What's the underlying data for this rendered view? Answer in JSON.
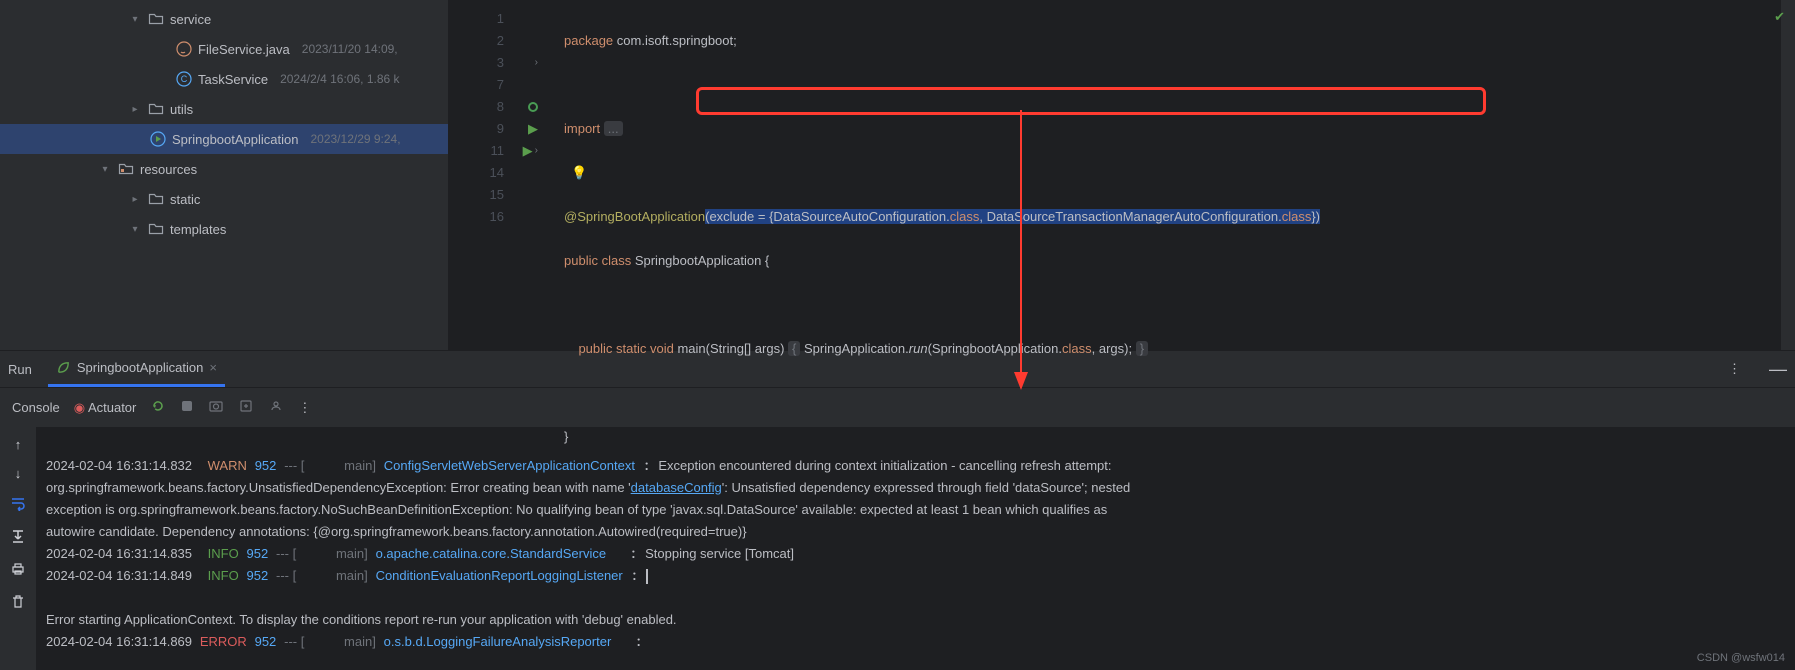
{
  "tree": {
    "service": {
      "name": "service",
      "children": [
        {
          "name": "FileService.java",
          "meta": "2023/11/20 14:09,"
        },
        {
          "name": "TaskService",
          "meta": "2024/2/4 16:06, 1.86 k"
        }
      ]
    },
    "utils": {
      "name": "utils"
    },
    "springApp": {
      "name": "SpringbootApplication",
      "meta": "2023/12/29 9:24,"
    },
    "resources": {
      "name": "resources",
      "children": [
        {
          "name": "static"
        },
        {
          "name": "templates"
        }
      ]
    }
  },
  "gutter": [
    "1",
    "2",
    "3",
    "7",
    "8",
    "9",
    "11",
    "14",
    "15",
    "16"
  ],
  "code": {
    "l1": {
      "kw": "package",
      "pkg": "com.isoft.springboot"
    },
    "l3": {
      "kw": "import",
      "dots": "..."
    },
    "l8": {
      "ann": "@SpringBootApplication"
    },
    "l9": {
      "cls": "SpringbootApplication"
    },
    "l11": {
      "main": "main"
    }
  },
  "run": {
    "title": "Run",
    "tab": "SpringbootApplication",
    "consoleTab": "Console",
    "actuatorTab": "Actuator"
  },
  "log": [
    {
      "ts": "2024-02-04 16:31:14.832",
      "level": "WARN",
      "pid": "952",
      "logger": "ConfigServletWebServerApplicationContext",
      "msg": "Exception encountered during context initialization - cancelling refresh attempt:",
      "msg2": "org.springframework.beans.factory.UnsatisfiedDependencyException: Error creating bean with name '",
      "link": "databaseConfig",
      "msg3": "': Unsatisfied dependency expressed through field 'dataSource'; nested",
      "msg4": "exception is org.springframework.beans.factory.NoSuchBeanDefinitionException: No qualifying bean of type 'javax.sql.DataSource' available: expected at least 1 bean which qualifies as",
      "msg5": "autowire candidate. Dependency annotations: {@org.springframework.beans.factory.annotation.Autowired(required=true)}"
    },
    {
      "ts": "2024-02-04 16:31:14.835",
      "level": "INFO",
      "pid": "952",
      "logger": "o.apache.catalina.core.StandardService",
      "msg": "Stopping service [Tomcat]"
    },
    {
      "ts": "2024-02-04 16:31:14.849",
      "level": "INFO",
      "pid": "952",
      "logger": "ConditionEvaluationReportLoggingListener"
    },
    {
      "msg": "Error starting ApplicationContext. To display the conditions report re-run your application with 'debug' enabled."
    },
    {
      "ts": "2024-02-04 16:31:14.869",
      "level": "ERROR",
      "pid": "952",
      "logger": "o.s.b.d.LoggingFailureAnalysisReporter"
    }
  ],
  "watermark": "CSDN @wsfw014"
}
